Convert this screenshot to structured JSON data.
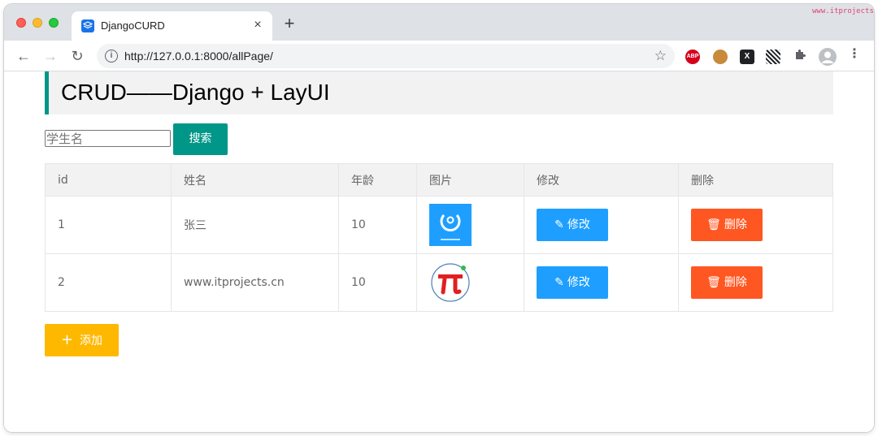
{
  "browser": {
    "tab_title": "DjangoCURD",
    "tab_close": "×",
    "new_tab": "+",
    "url": "http://127.0.0.1:8000/allPage/",
    "back": "←",
    "forward": "→",
    "reload": "↻",
    "extensions": {
      "abp": "ABP",
      "x": "X"
    },
    "watermark": "www.itprojects.cn"
  },
  "page": {
    "title": "CRUD——Django + LayUI",
    "search_placeholder": "学生名",
    "search_button": "搜索",
    "add_button": "添加"
  },
  "table": {
    "headers": [
      "id",
      "姓名",
      "年龄",
      "图片",
      "修改",
      "删除"
    ],
    "rows": [
      {
        "id": "1",
        "name": "张三",
        "age": "10",
        "image": "layui-logo",
        "edit": "修改",
        "delete": "删除"
      },
      {
        "id": "2",
        "name": "www.itprojects.cn",
        "age": "10",
        "image": "pi-logo",
        "edit": "修改",
        "delete": "删除"
      }
    ]
  },
  "colors": {
    "accent_teal": "#009688",
    "edit_blue": "#1e9fff",
    "delete_red": "#ff5722",
    "add_yellow": "#ffb800"
  }
}
